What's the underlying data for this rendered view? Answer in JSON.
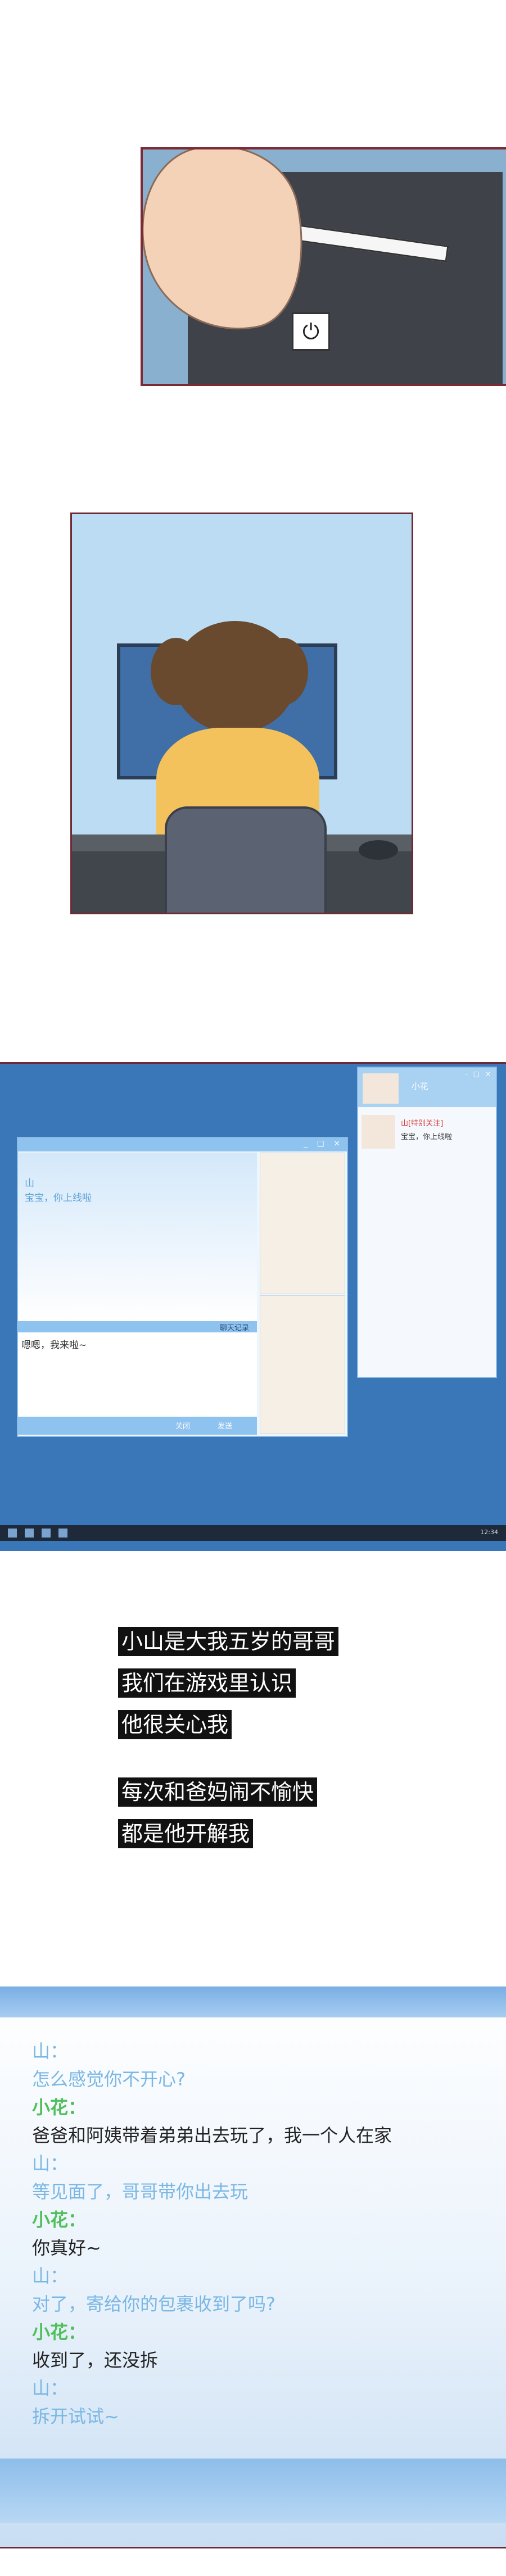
{
  "panel1": {
    "power_symbol": "⏻"
  },
  "panel3": {
    "chat_window": {
      "window_controls": "_ □ ×",
      "sender_name": "山",
      "sender_message": "宝宝，你上线啦",
      "history_label": "聊天记录",
      "input_text": "嗯嗯，我来啦~",
      "close_label": "关闭",
      "send_label": "发送"
    },
    "side_window": {
      "title": "小花",
      "controls": "- □ ×",
      "contact_name": "山[特别关注]",
      "contact_message": "宝宝，你上线啦"
    },
    "taskbar_clock": "12:34"
  },
  "narration": [
    "小山是大我五岁的哥哥",
    "我们在游戏里认识",
    "他很关心我",
    "每次和爸妈闹不愉快",
    "都是他开解我"
  ],
  "chat_log": [
    {
      "who": "shan",
      "text": "山："
    },
    {
      "who": "shan",
      "text": "怎么感觉你不开心?"
    },
    {
      "who": "hua",
      "text": "小花："
    },
    {
      "who": "hua_say",
      "text": "爸爸和阿姨带着弟弟出去玩了，我一个人在家"
    },
    {
      "who": "shan",
      "text": "山："
    },
    {
      "who": "shan",
      "text": "等见面了，哥哥带你出去玩"
    },
    {
      "who": "hua",
      "text": "小花："
    },
    {
      "who": "hua_say",
      "text": "你真好~"
    },
    {
      "who": "shan",
      "text": "山："
    },
    {
      "who": "shan",
      "text": "对了，寄给你的包裹收到了吗?"
    },
    {
      "who": "hua",
      "text": "小花："
    },
    {
      "who": "hua_say",
      "text": "收到了，还没拆"
    },
    {
      "who": "shan",
      "text": "山："
    },
    {
      "who": "shan",
      "text": "拆开试试~"
    }
  ]
}
